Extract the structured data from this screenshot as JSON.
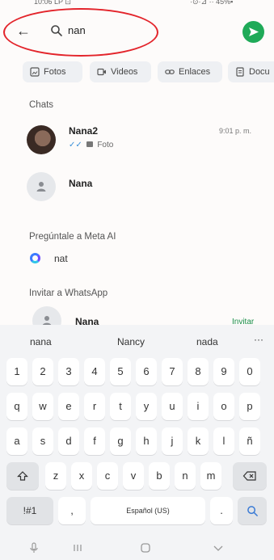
{
  "status_bar": {
    "time": "10:06 LP ⊡",
    "right": "·⊙·⊿ ·· 45%▪"
  },
  "search": {
    "back_icon": "arrow-left-icon",
    "search_icon": "search-icon",
    "query": "nan",
    "send_icon": "send-icon",
    "accent": "#1faa58"
  },
  "filters": [
    {
      "label": "Fotos",
      "icon": "photo-icon"
    },
    {
      "label": "Videos",
      "icon": "video-icon"
    },
    {
      "label": "Enlaces",
      "icon": "link-icon"
    },
    {
      "label": "Docu",
      "icon": "document-icon"
    }
  ],
  "chats": {
    "heading": "Chats",
    "items": [
      {
        "name": "Nana2",
        "time": "9:01 p. m.",
        "sub": "Foto"
      },
      {
        "name": "Nana"
      }
    ]
  },
  "meta_ai": {
    "heading": "Pregúntale a Meta AI",
    "item": "nat"
  },
  "invite": {
    "heading": "Invitar a WhatsApp",
    "name": "Nana",
    "action": "Invitar"
  },
  "keyboard": {
    "suggestions": [
      "nana",
      "Nancy",
      "nada",
      "···"
    ],
    "row_numbers": [
      "1",
      "2",
      "3",
      "4",
      "5",
      "6",
      "7",
      "8",
      "9",
      "0"
    ],
    "row_top": [
      "q",
      "w",
      "e",
      "r",
      "t",
      "y",
      "u",
      "i",
      "o",
      "p"
    ],
    "row_mid": [
      "a",
      "s",
      "d",
      "f",
      "g",
      "h",
      "j",
      "k",
      "l",
      "ñ"
    ],
    "row_bottom": [
      "z",
      "x",
      "c",
      "v",
      "b",
      "n",
      "m"
    ],
    "symbols": "!#1",
    "comma": ",",
    "space": "Español (US)",
    "period": "."
  }
}
